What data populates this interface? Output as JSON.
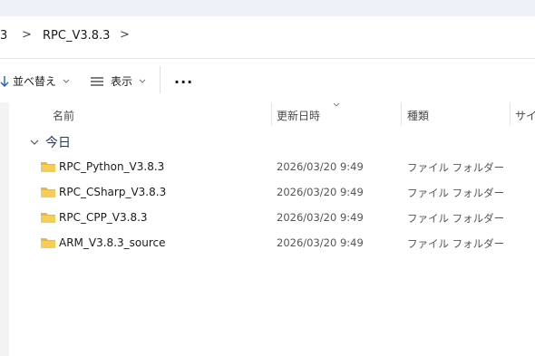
{
  "breadcrumb": {
    "prev_fragment": "3",
    "current": "RPC_V3.8.3",
    "separator": ">"
  },
  "toolbar": {
    "sort_label": "並べ替え",
    "view_label": "表示",
    "more_label": "..."
  },
  "columns": {
    "name": "名前",
    "modified": "更新日時",
    "type": "種類",
    "size": "サイズ"
  },
  "group": {
    "label": "今日"
  },
  "files": [
    {
      "name": "RPC_Python_V3.8.3",
      "date": "2026/03/20 9:49",
      "type": "ファイル フォルダー"
    },
    {
      "name": "RPC_CSharp_V3.8.3",
      "date": "2026/03/20 9:49",
      "type": "ファイル フォルダー"
    },
    {
      "name": "RPC_CPP_V3.8.3",
      "date": "2026/03/20 9:49",
      "type": "ファイル フォルダー"
    },
    {
      "name": "ARM_V3.8.3_source",
      "date": "2026/03/20 9:49",
      "type": "ファイル フォルダー"
    }
  ],
  "colors": {
    "folder": "#f5c542",
    "accent": "#1f3a6b"
  }
}
